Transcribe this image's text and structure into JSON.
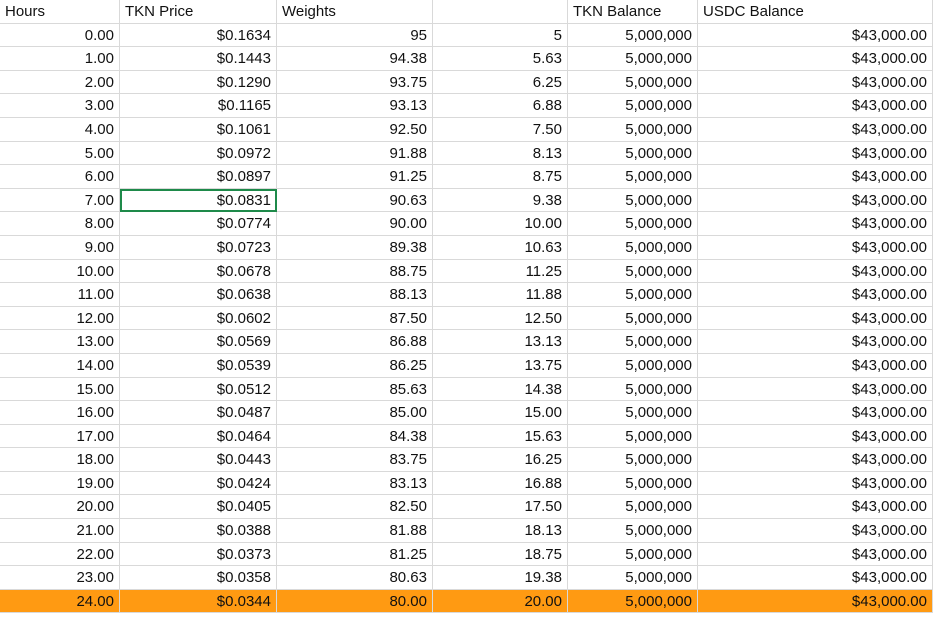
{
  "colors": {
    "highlight_row": "#ff9a12",
    "selection": "#1e8a4a",
    "grid": "#d9d9d9"
  },
  "headers": [
    "Hours",
    "TKN Price",
    "Weights",
    "",
    "TKN Balance",
    "USDC Balance"
  ],
  "rows": [
    [
      "0.00",
      "$0.1634",
      "95",
      "5",
      "5,000,000",
      "$43,000.00"
    ],
    [
      "1.00",
      "$0.1443",
      "94.38",
      "5.63",
      "5,000,000",
      "$43,000.00"
    ],
    [
      "2.00",
      "$0.1290",
      "93.75",
      "6.25",
      "5,000,000",
      "$43,000.00"
    ],
    [
      "3.00",
      "$0.1165",
      "93.13",
      "6.88",
      "5,000,000",
      "$43,000.00"
    ],
    [
      "4.00",
      "$0.1061",
      "92.50",
      "7.50",
      "5,000,000",
      "$43,000.00"
    ],
    [
      "5.00",
      "$0.0972",
      "91.88",
      "8.13",
      "5,000,000",
      "$43,000.00"
    ],
    [
      "6.00",
      "$0.0897",
      "91.25",
      "8.75",
      "5,000,000",
      "$43,000.00"
    ],
    [
      "7.00",
      "$0.0831",
      "90.63",
      "9.38",
      "5,000,000",
      "$43,000.00"
    ],
    [
      "8.00",
      "$0.0774",
      "90.00",
      "10.00",
      "5,000,000",
      "$43,000.00"
    ],
    [
      "9.00",
      "$0.0723",
      "89.38",
      "10.63",
      "5,000,000",
      "$43,000.00"
    ],
    [
      "10.00",
      "$0.0678",
      "88.75",
      "11.25",
      "5,000,000",
      "$43,000.00"
    ],
    [
      "11.00",
      "$0.0638",
      "88.13",
      "11.88",
      "5,000,000",
      "$43,000.00"
    ],
    [
      "12.00",
      "$0.0602",
      "87.50",
      "12.50",
      "5,000,000",
      "$43,000.00"
    ],
    [
      "13.00",
      "$0.0569",
      "86.88",
      "13.13",
      "5,000,000",
      "$43,000.00"
    ],
    [
      "14.00",
      "$0.0539",
      "86.25",
      "13.75",
      "5,000,000",
      "$43,000.00"
    ],
    [
      "15.00",
      "$0.0512",
      "85.63",
      "14.38",
      "5,000,000",
      "$43,000.00"
    ],
    [
      "16.00",
      "$0.0487",
      "85.00",
      "15.00",
      "5,000,000",
      "$43,000.00"
    ],
    [
      "17.00",
      "$0.0464",
      "84.38",
      "15.63",
      "5,000,000",
      "$43,000.00"
    ],
    [
      "18.00",
      "$0.0443",
      "83.75",
      "16.25",
      "5,000,000",
      "$43,000.00"
    ],
    [
      "19.00",
      "$0.0424",
      "83.13",
      "16.88",
      "5,000,000",
      "$43,000.00"
    ],
    [
      "20.00",
      "$0.0405",
      "82.50",
      "17.50",
      "5,000,000",
      "$43,000.00"
    ],
    [
      "21.00",
      "$0.0388",
      "81.88",
      "18.13",
      "5,000,000",
      "$43,000.00"
    ],
    [
      "22.00",
      "$0.0373",
      "81.25",
      "18.75",
      "5,000,000",
      "$43,000.00"
    ],
    [
      "23.00",
      "$0.0358",
      "80.63",
      "19.38",
      "5,000,000",
      "$43,000.00"
    ],
    [
      "24.00",
      "$0.0344",
      "80.00",
      "20.00",
      "5,000,000",
      "$43,000.00"
    ]
  ]
}
